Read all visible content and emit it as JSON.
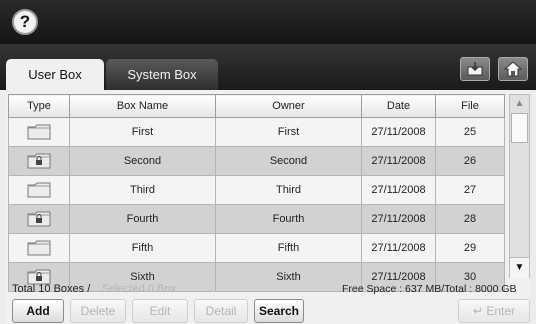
{
  "header": {
    "help_label": "?"
  },
  "tabs": [
    {
      "label": "User Box",
      "active": true
    },
    {
      "label": "System Box",
      "active": false
    }
  ],
  "toolbar_icons": [
    "import-icon",
    "home-icon"
  ],
  "table": {
    "columns": [
      "Type",
      "Box Name",
      "Owner",
      "Date",
      "File"
    ],
    "rows": [
      {
        "type": "folder",
        "locked": false,
        "name": "First",
        "owner": "First",
        "date": "27/11/2008",
        "file": "25"
      },
      {
        "type": "folder",
        "locked": true,
        "name": "Second",
        "owner": "Second",
        "date": "27/11/2008",
        "file": "26"
      },
      {
        "type": "folder",
        "locked": false,
        "name": "Third",
        "owner": "Third",
        "date": "27/11/2008",
        "file": "27"
      },
      {
        "type": "folder",
        "locked": true,
        "name": "Fourth",
        "owner": "Fourth",
        "date": "27/11/2008",
        "file": "28"
      },
      {
        "type": "folder",
        "locked": false,
        "name": "Fifth",
        "owner": "Fifth",
        "date": "27/11/2008",
        "file": "29"
      },
      {
        "type": "folder",
        "locked": true,
        "name": "Sixth",
        "owner": "Sixth",
        "date": "27/11/2008",
        "file": "30"
      }
    ]
  },
  "status": {
    "total": "Total 10 Boxes /",
    "selected": "Selected 0 Box",
    "space": "Free Space : 637 MB/Total : 8000 GB"
  },
  "buttons": {
    "add": "Add",
    "delete": "Delete",
    "edit": "Edit",
    "detail": "Detail",
    "search": "Search",
    "enter": "Enter"
  }
}
